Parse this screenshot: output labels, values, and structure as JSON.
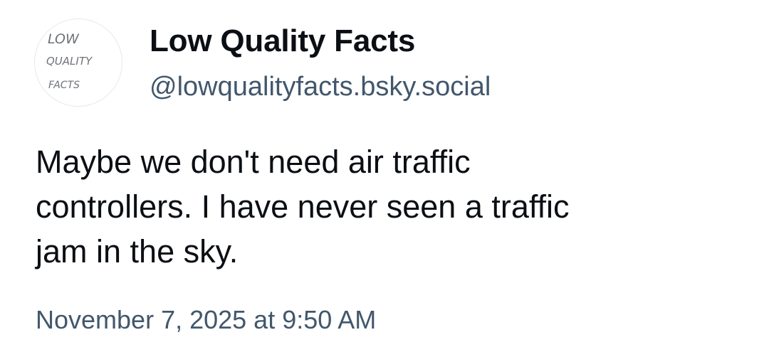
{
  "post": {
    "author": {
      "display_name": "Low Quality Facts",
      "handle": "@lowqualityfacts.bsky.social",
      "avatar": {
        "line1": "LOW",
        "line2": "QUALITY",
        "line3": "FACTS"
      }
    },
    "text": "Maybe we don't need air traffic\ncontrollers. I have never seen a traffic\njam in the sky.",
    "timestamp": "November 7, 2025 at 9:50 AM"
  },
  "colors": {
    "text_primary": "#0b0f14",
    "text_secondary": "#42576c",
    "background": "#ffffff",
    "avatar_border": "#e6e8ec"
  }
}
